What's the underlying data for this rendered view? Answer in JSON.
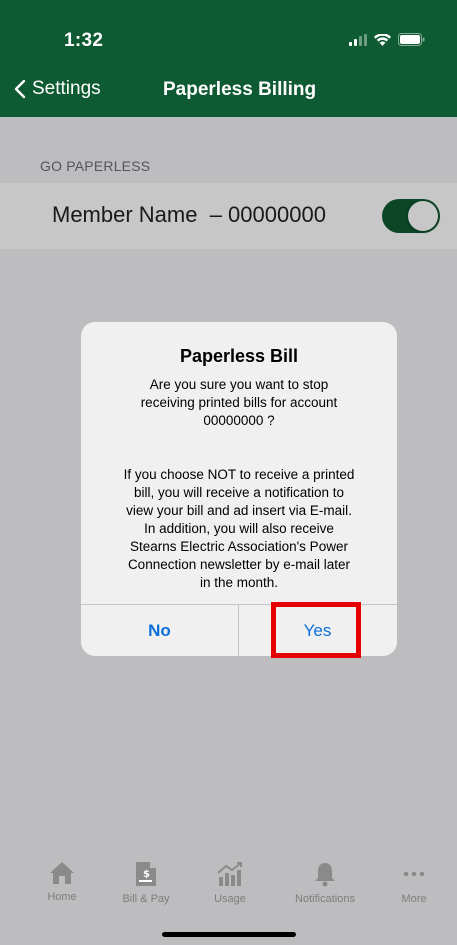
{
  "status_bar": {
    "time": "1:32"
  },
  "nav": {
    "back_label": "Settings",
    "title": "Paperless Billing"
  },
  "section": {
    "header": "GO PAPERLESS"
  },
  "member_row": {
    "label": "Member Name  – 00000000",
    "toggle_on": true
  },
  "alert": {
    "title": "Paperless Bill",
    "body": "Are you sure you want to stop\nreceiving printed bills for account",
    "account": "00000000 ?",
    "body2": "If you choose NOT to receive a printed\nbill, you will receive a notification to\nview your bill and ad insert via E-mail.\nIn addition, you will also receive\nStearns Electric Association's Power\nConnection newsletter by e-mail later\nin the month.",
    "no_label": "No",
    "yes_label": "Yes"
  },
  "tabbar": {
    "items": [
      {
        "label": "Home",
        "icon": "home-icon"
      },
      {
        "label": "Bill & Pay",
        "icon": "bill-icon"
      },
      {
        "label": "Usage",
        "icon": "usage-chart-icon"
      },
      {
        "label": "Notifications",
        "icon": "bell-icon"
      },
      {
        "label": "More",
        "icon": "more-dots-icon"
      }
    ]
  },
  "colors": {
    "brand_green": "#0e5a32",
    "link_blue": "#0a6fd8",
    "highlight_red": "#e60000"
  }
}
